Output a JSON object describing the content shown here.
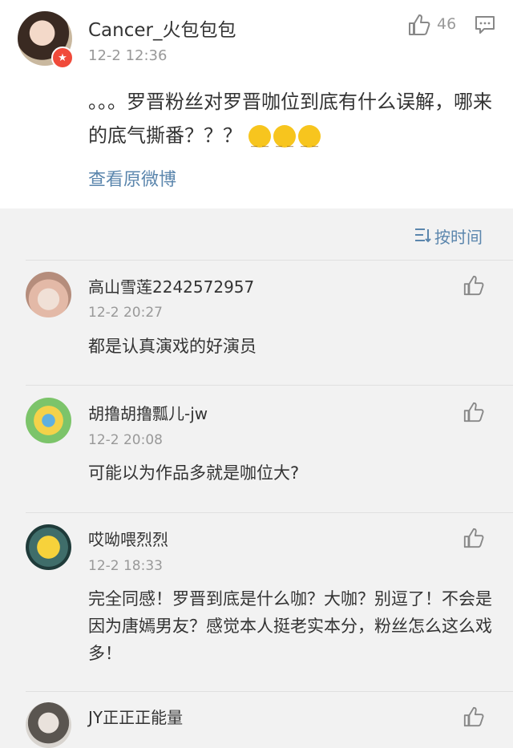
{
  "post": {
    "username": "Cancer_火包包包",
    "time": "12-2 12:36",
    "like_count": "46",
    "text": "。。。罗晋粉丝对罗晋咖位到底有什么误解，哪来的底气撕番？？？",
    "origin_link": "查看原微博"
  },
  "sort": {
    "label": "按时间"
  },
  "comments": [
    {
      "name": "高山雪莲2242572957",
      "time": "12-2 20:27",
      "text": "都是认真演戏的好演员"
    },
    {
      "name": "胡撸胡撸瓢儿-jw",
      "time": "12-2 20:08",
      "text": "可能以为作品多就是咖位大?"
    },
    {
      "name": "哎呦喂烈烈",
      "time": "12-2 18:33",
      "text": "完全同感！罗晋到底是什么咖？大咖？别逗了！不会是因为唐嫣男友？感觉本人挺老实本分，粉丝怎么这么戏多！"
    },
    {
      "name": "JY正正正能量",
      "time": "",
      "text": ""
    }
  ],
  "colors": {
    "link": "#5b86ad",
    "meta": "#999999",
    "text": "#333333",
    "background": "#f2f2f2"
  }
}
